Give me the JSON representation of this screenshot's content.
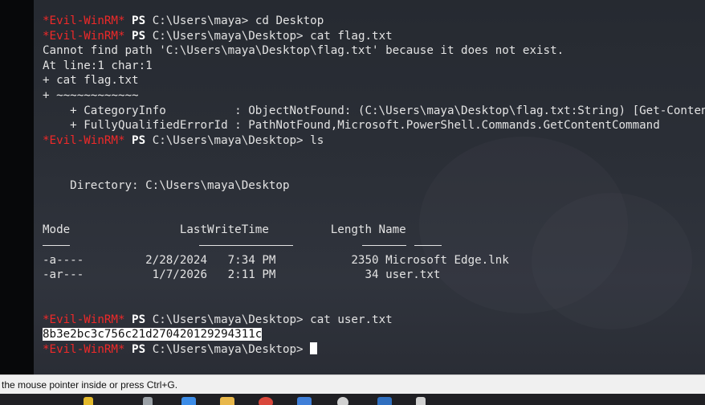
{
  "terminal": {
    "prompt_name": "*Evil-WinRM*",
    "prompt_ps": "PS",
    "lines": [
      {
        "kind": "prompt",
        "path": "C:\\Users\\maya>",
        "cmd": "cd Desktop"
      },
      {
        "kind": "prompt",
        "path": "C:\\Users\\maya\\Desktop>",
        "cmd": "cat flag.txt"
      },
      {
        "kind": "text",
        "text": "Cannot find path 'C:\\Users\\maya\\Desktop\\flag.txt' because it does not exist."
      },
      {
        "kind": "text",
        "text": "At line:1 char:1"
      },
      {
        "kind": "text",
        "text": "+ cat flag.txt"
      },
      {
        "kind": "text",
        "text": "+ ~~~~~~~~~~~~"
      },
      {
        "kind": "text",
        "text": "    + CategoryInfo          : ObjectNotFound: (C:\\Users\\maya\\Desktop\\flag.txt:String) [Get-Content], ItemNotFoundException"
      },
      {
        "kind": "text",
        "text": "    + FullyQualifiedErrorId : PathNotFound,Microsoft.PowerShell.Commands.GetContentCommand"
      },
      {
        "kind": "prompt",
        "path": "C:\\Users\\maya\\Desktop>",
        "cmd": "ls"
      },
      {
        "kind": "blank"
      },
      {
        "kind": "blank"
      },
      {
        "kind": "text",
        "text": "    Directory: C:\\Users\\maya\\Desktop"
      },
      {
        "kind": "blank"
      },
      {
        "kind": "blank"
      },
      {
        "kind": "text",
        "text": "Mode                LastWriteTime         Length Name"
      },
      {
        "kind": "underline"
      },
      {
        "kind": "text",
        "text": "-a----         2/28/2024   7:34 PM           2350 Microsoft Edge.lnk"
      },
      {
        "kind": "text",
        "text": "-ar---          1/7/2026   2:11 PM             34 user.txt"
      },
      {
        "kind": "blank"
      },
      {
        "kind": "blank"
      },
      {
        "kind": "prompt",
        "path": "C:\\Users\\maya\\Desktop>",
        "cmd": "cat user.txt"
      },
      {
        "kind": "selected",
        "text": "8b3e2bc3c756c21d270420129294311c"
      },
      {
        "kind": "prompt_cursor",
        "path": "C:\\Users\\maya\\Desktop>",
        "cmd": ""
      }
    ]
  },
  "status_bar": {
    "text": "the mouse pointer inside or press Ctrl+G."
  },
  "colors": {
    "prompt_red": "#ef2929",
    "text": "#e3e3e3",
    "background": "#2b2f37"
  }
}
